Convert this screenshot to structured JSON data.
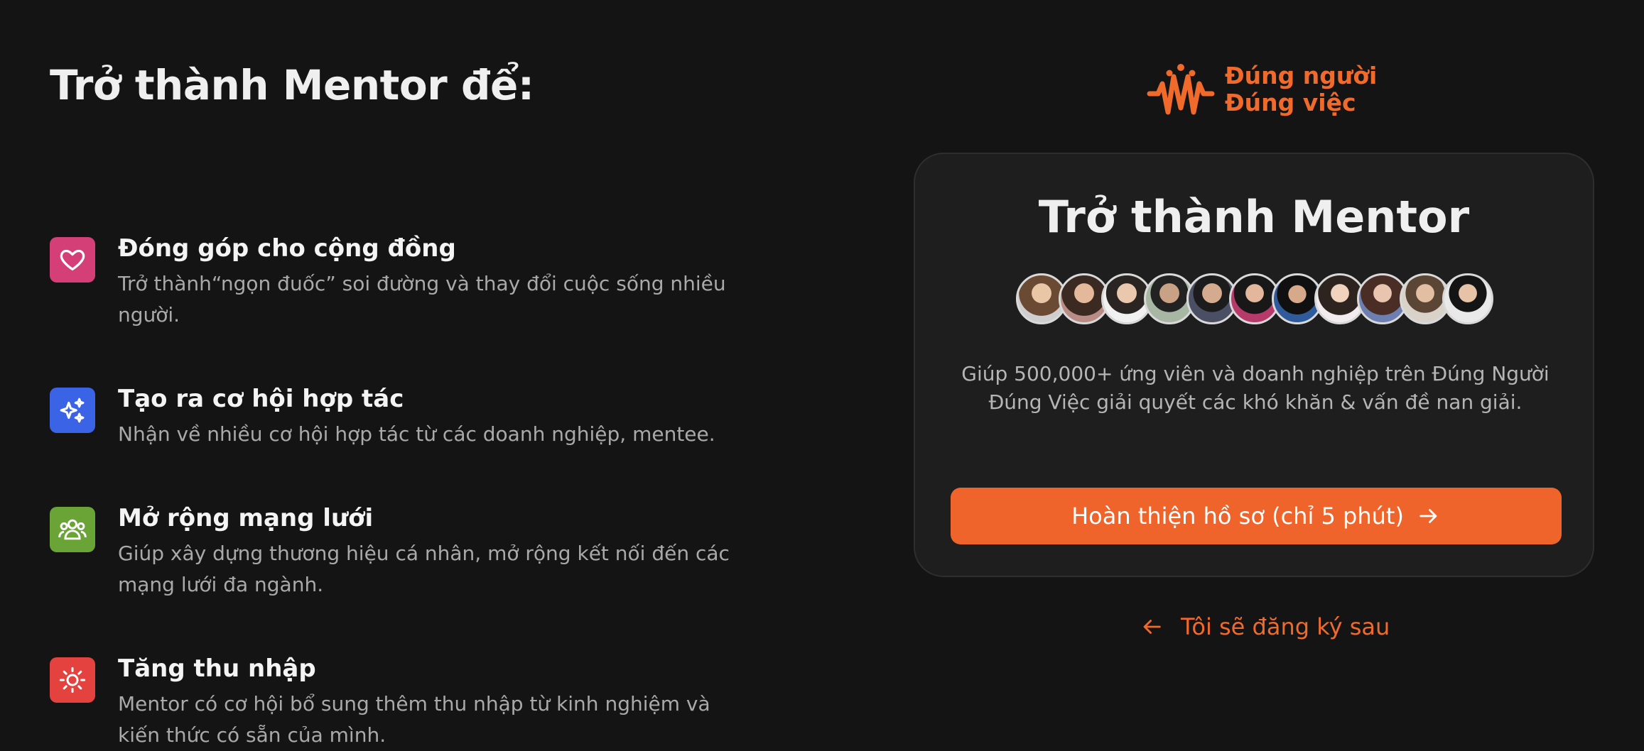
{
  "left": {
    "heading": "Trở thành Mentor để:",
    "benefits": [
      {
        "icon": "heart-icon",
        "color": "#d43f78",
        "title": "Đóng góp cho cộng đồng",
        "desc": "Trở thành“ngọn đuốc” soi đường và thay đổi cuộc sống nhiều người."
      },
      {
        "icon": "sparkles-icon",
        "color": "#3b63e6",
        "title": "Tạo ra cơ hội hợp tác",
        "desc": "Nhận về nhiều cơ hội hợp tác từ các doanh nghiệp, mentee."
      },
      {
        "icon": "group-icon",
        "color": "#6aa336",
        "title": "Mở rộng mạng lưới",
        "desc": "Giúp xây dựng thương hiệu cá nhân, mở rộng kết nối đến các mạng lưới đa ngành."
      },
      {
        "icon": "sun-icon",
        "color": "#e4423f",
        "title": "Tăng thu nhập",
        "desc": "Mentor có cơ hội bổ sung thêm thu nhập từ kinh nghiệm và kiến thức có sẵn của mình."
      }
    ]
  },
  "brand": {
    "line1": "Đúng người",
    "line2": "Đúng việc",
    "color": "#f06a2c"
  },
  "card": {
    "title": "Trở thành Mentor",
    "avatar_count": 11,
    "description": "Giúp 500,000+ ứng viên và doanh nghiệp trên Đúng Người Đúng Việc giải quyết các khó khăn & vấn đề nan giải.",
    "cta_label": "Hoàn thiện hồ sơ (chỉ 5 phút)",
    "cta_color": "#ef642b"
  },
  "later_label": "Tôi sẽ đăng ký sau"
}
